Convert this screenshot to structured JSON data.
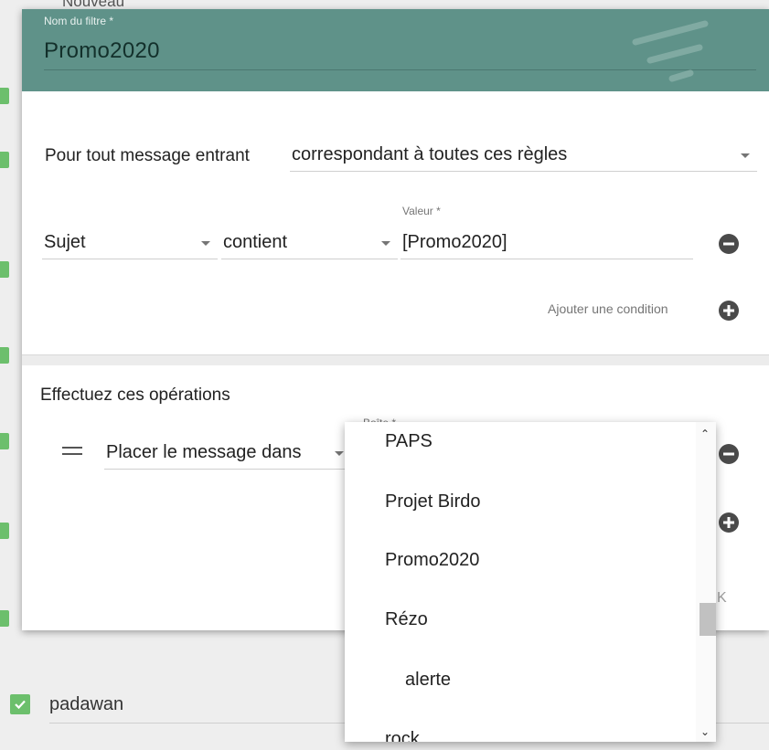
{
  "background": {
    "top_text": "Nouveau",
    "row_label": "padawan"
  },
  "dialog": {
    "name_label": "Nom du filtre *",
    "name_value": "Promo2020",
    "incoming_label": "Pour tout message entrant",
    "match_mode": "correspondant à toutes ces règles",
    "condition": {
      "field": "Sujet",
      "operator": "contient",
      "value_label": "Valeur *",
      "value": "[Promo2020]"
    },
    "add_condition": "Ajouter une condition",
    "operations_title": "Effectuez ces opérations",
    "action": {
      "type": "Placer le message dans",
      "box_label": "Boîte *"
    },
    "ok_fragment": "K"
  },
  "dropdown": {
    "items": [
      "PAPS",
      "Projet Birdo",
      "Promo2020",
      "Rézo",
      "alerte",
      "rock"
    ]
  },
  "colors": {
    "header": "#5f9289",
    "check_green": "#6cbf6c"
  }
}
